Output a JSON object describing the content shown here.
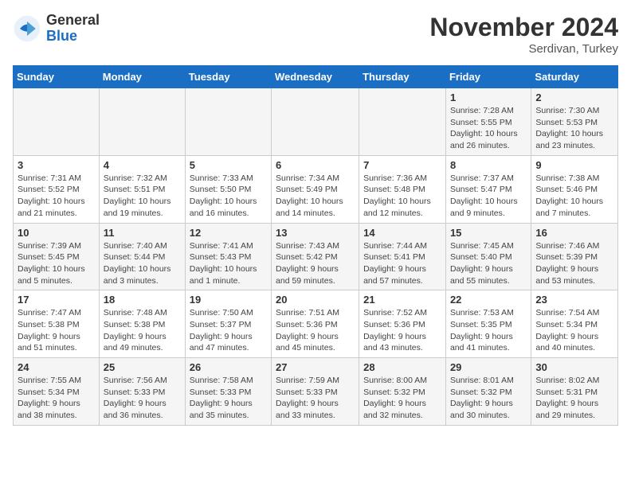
{
  "header": {
    "logo_line1": "General",
    "logo_line2": "Blue",
    "month": "November 2024",
    "location": "Serdivan, Turkey"
  },
  "weekdays": [
    "Sunday",
    "Monday",
    "Tuesday",
    "Wednesday",
    "Thursday",
    "Friday",
    "Saturday"
  ],
  "weeks": [
    [
      {
        "day": "",
        "info": ""
      },
      {
        "day": "",
        "info": ""
      },
      {
        "day": "",
        "info": ""
      },
      {
        "day": "",
        "info": ""
      },
      {
        "day": "",
        "info": ""
      },
      {
        "day": "1",
        "info": "Sunrise: 7:28 AM\nSunset: 5:55 PM\nDaylight: 10 hours and 26 minutes."
      },
      {
        "day": "2",
        "info": "Sunrise: 7:30 AM\nSunset: 5:53 PM\nDaylight: 10 hours and 23 minutes."
      }
    ],
    [
      {
        "day": "3",
        "info": "Sunrise: 7:31 AM\nSunset: 5:52 PM\nDaylight: 10 hours and 21 minutes."
      },
      {
        "day": "4",
        "info": "Sunrise: 7:32 AM\nSunset: 5:51 PM\nDaylight: 10 hours and 19 minutes."
      },
      {
        "day": "5",
        "info": "Sunrise: 7:33 AM\nSunset: 5:50 PM\nDaylight: 10 hours and 16 minutes."
      },
      {
        "day": "6",
        "info": "Sunrise: 7:34 AM\nSunset: 5:49 PM\nDaylight: 10 hours and 14 minutes."
      },
      {
        "day": "7",
        "info": "Sunrise: 7:36 AM\nSunset: 5:48 PM\nDaylight: 10 hours and 12 minutes."
      },
      {
        "day": "8",
        "info": "Sunrise: 7:37 AM\nSunset: 5:47 PM\nDaylight: 10 hours and 9 minutes."
      },
      {
        "day": "9",
        "info": "Sunrise: 7:38 AM\nSunset: 5:46 PM\nDaylight: 10 hours and 7 minutes."
      }
    ],
    [
      {
        "day": "10",
        "info": "Sunrise: 7:39 AM\nSunset: 5:45 PM\nDaylight: 10 hours and 5 minutes."
      },
      {
        "day": "11",
        "info": "Sunrise: 7:40 AM\nSunset: 5:44 PM\nDaylight: 10 hours and 3 minutes."
      },
      {
        "day": "12",
        "info": "Sunrise: 7:41 AM\nSunset: 5:43 PM\nDaylight: 10 hours and 1 minute."
      },
      {
        "day": "13",
        "info": "Sunrise: 7:43 AM\nSunset: 5:42 PM\nDaylight: 9 hours and 59 minutes."
      },
      {
        "day": "14",
        "info": "Sunrise: 7:44 AM\nSunset: 5:41 PM\nDaylight: 9 hours and 57 minutes."
      },
      {
        "day": "15",
        "info": "Sunrise: 7:45 AM\nSunset: 5:40 PM\nDaylight: 9 hours and 55 minutes."
      },
      {
        "day": "16",
        "info": "Sunrise: 7:46 AM\nSunset: 5:39 PM\nDaylight: 9 hours and 53 minutes."
      }
    ],
    [
      {
        "day": "17",
        "info": "Sunrise: 7:47 AM\nSunset: 5:38 PM\nDaylight: 9 hours and 51 minutes."
      },
      {
        "day": "18",
        "info": "Sunrise: 7:48 AM\nSunset: 5:38 PM\nDaylight: 9 hours and 49 minutes."
      },
      {
        "day": "19",
        "info": "Sunrise: 7:50 AM\nSunset: 5:37 PM\nDaylight: 9 hours and 47 minutes."
      },
      {
        "day": "20",
        "info": "Sunrise: 7:51 AM\nSunset: 5:36 PM\nDaylight: 9 hours and 45 minutes."
      },
      {
        "day": "21",
        "info": "Sunrise: 7:52 AM\nSunset: 5:36 PM\nDaylight: 9 hours and 43 minutes."
      },
      {
        "day": "22",
        "info": "Sunrise: 7:53 AM\nSunset: 5:35 PM\nDaylight: 9 hours and 41 minutes."
      },
      {
        "day": "23",
        "info": "Sunrise: 7:54 AM\nSunset: 5:34 PM\nDaylight: 9 hours and 40 minutes."
      }
    ],
    [
      {
        "day": "24",
        "info": "Sunrise: 7:55 AM\nSunset: 5:34 PM\nDaylight: 9 hours and 38 minutes."
      },
      {
        "day": "25",
        "info": "Sunrise: 7:56 AM\nSunset: 5:33 PM\nDaylight: 9 hours and 36 minutes."
      },
      {
        "day": "26",
        "info": "Sunrise: 7:58 AM\nSunset: 5:33 PM\nDaylight: 9 hours and 35 minutes."
      },
      {
        "day": "27",
        "info": "Sunrise: 7:59 AM\nSunset: 5:33 PM\nDaylight: 9 hours and 33 minutes."
      },
      {
        "day": "28",
        "info": "Sunrise: 8:00 AM\nSunset: 5:32 PM\nDaylight: 9 hours and 32 minutes."
      },
      {
        "day": "29",
        "info": "Sunrise: 8:01 AM\nSunset: 5:32 PM\nDaylight: 9 hours and 30 minutes."
      },
      {
        "day": "30",
        "info": "Sunrise: 8:02 AM\nSunset: 5:31 PM\nDaylight: 9 hours and 29 minutes."
      }
    ]
  ]
}
